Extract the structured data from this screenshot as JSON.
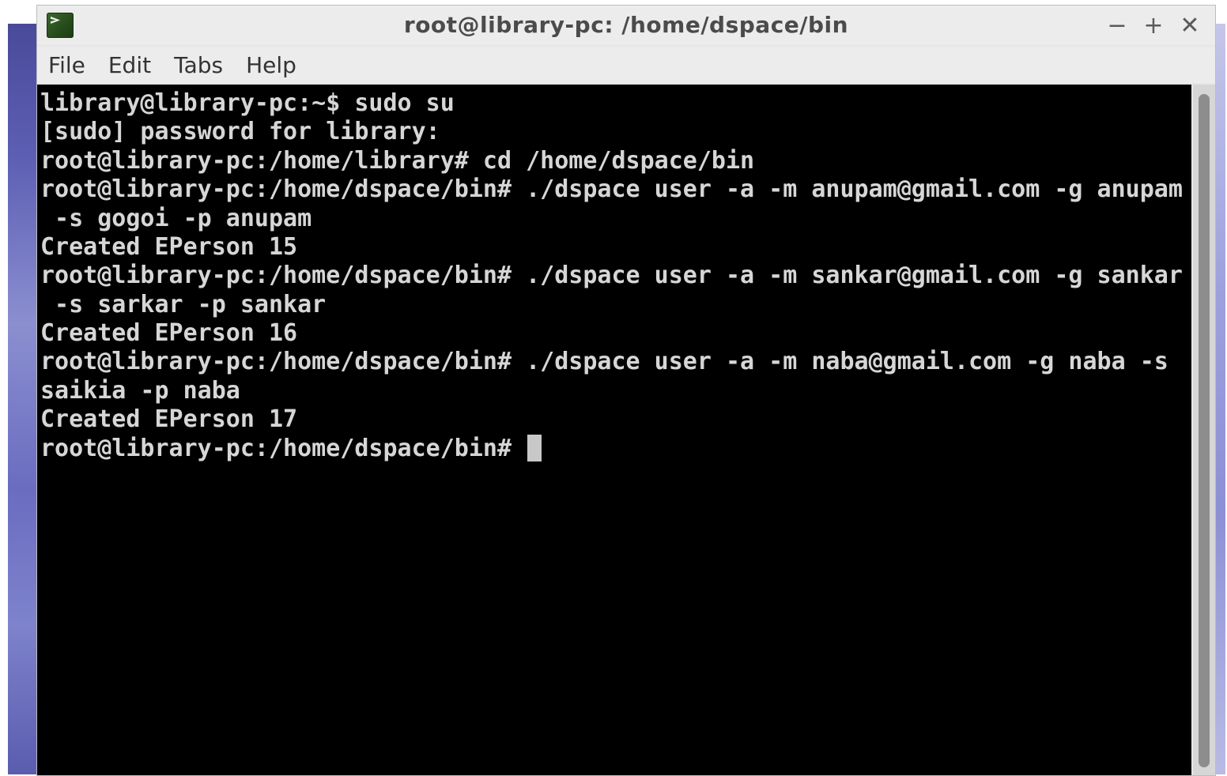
{
  "window": {
    "title": "root@library-pc: /home/dspace/bin",
    "controls": {
      "minimize": "−",
      "maximize": "+",
      "close": "✕"
    },
    "icon": "terminal-icon"
  },
  "menu": {
    "items": [
      {
        "label": "File"
      },
      {
        "label": "Edit"
      },
      {
        "label": "Tabs"
      },
      {
        "label": "Help"
      }
    ]
  },
  "terminal": {
    "lines": [
      "library@library-pc:~$ sudo su",
      "[sudo] password for library:",
      "root@library-pc:/home/library# cd /home/dspace/bin",
      "root@library-pc:/home/dspace/bin# ./dspace user -a -m anupam@gmail.com -g anupam",
      " -s gogoi -p anupam",
      "Created EPerson 15",
      "root@library-pc:/home/dspace/bin# ./dspace user -a -m sankar@gmail.com -g sankar",
      " -s sarkar -p sankar",
      "Created EPerson 16",
      "root@library-pc:/home/dspace/bin# ./dspace user -a -m naba@gmail.com -g naba -s",
      "saikia -p naba",
      "Created EPerson 17"
    ],
    "prompt": "root@library-pc:/home/dspace/bin# "
  },
  "colors": {
    "terminal_bg": "#000000",
    "terminal_fg": "#d6d6d6",
    "chrome_bg": "#ececec",
    "desktop_accent": "#5d5fb4"
  }
}
